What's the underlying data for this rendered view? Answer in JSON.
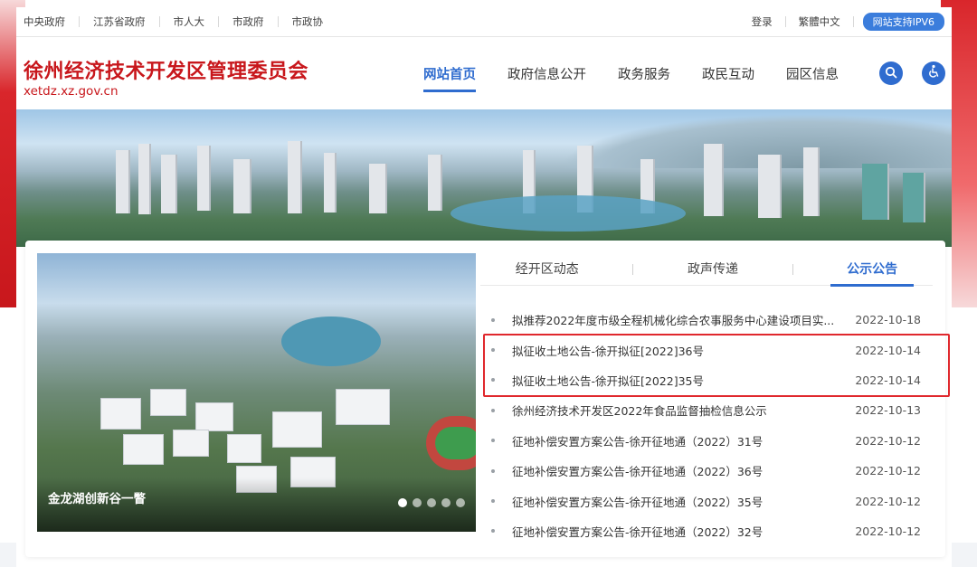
{
  "topbar": {
    "links": [
      "中央政府",
      "江苏省政府",
      "市人大",
      "市政府",
      "市政协"
    ],
    "login": "登录",
    "traditional": "繁體中文",
    "ipv6": "网站支持IPV6"
  },
  "header": {
    "title": "徐州经济技术开发区管理委员会",
    "domain": "xetdz.xz.gov.cn",
    "nav": [
      {
        "label": "网站首页",
        "active": true
      },
      {
        "label": "政府信息公开",
        "active": false
      },
      {
        "label": "政务服务",
        "active": false
      },
      {
        "label": "政民互动",
        "active": false
      },
      {
        "label": "园区信息",
        "active": false
      }
    ]
  },
  "feature": {
    "caption": "金龙湖创新谷一瞥",
    "slides": 5,
    "current_slide": 1
  },
  "tabs": [
    {
      "label": "经开区动态",
      "active": false
    },
    {
      "label": "政声传递",
      "active": false
    },
    {
      "label": "公示公告",
      "active": true
    }
  ],
  "notices": [
    {
      "title": "拟推荐2022年度市级全程机械化综合农事服务中心建设项目实...",
      "date": "2022-10-18"
    },
    {
      "title": "拟征收土地公告-徐开拟征[2022]36号",
      "date": "2022-10-14"
    },
    {
      "title": "拟征收土地公告-徐开拟征[2022]35号",
      "date": "2022-10-14"
    },
    {
      "title": "徐州经济技术开发区2022年食品监督抽检信息公示",
      "date": "2022-10-13"
    },
    {
      "title": "征地补偿安置方案公告-徐开征地通（2022）31号",
      "date": "2022-10-12"
    },
    {
      "title": "征地补偿安置方案公告-徐开征地通（2022）36号",
      "date": "2022-10-12"
    },
    {
      "title": "征地补偿安置方案公告-徐开征地通（2022）35号",
      "date": "2022-10-12"
    },
    {
      "title": "征地补偿安置方案公告-徐开征地通（2022）32号",
      "date": "2022-10-12"
    }
  ],
  "colors": {
    "brand_red": "#c8171c",
    "accent_blue": "#2f6ccf",
    "highlight_red": "#e0282d"
  },
  "icons": {
    "search": "search-icon",
    "accessibility": "accessibility-icon"
  }
}
